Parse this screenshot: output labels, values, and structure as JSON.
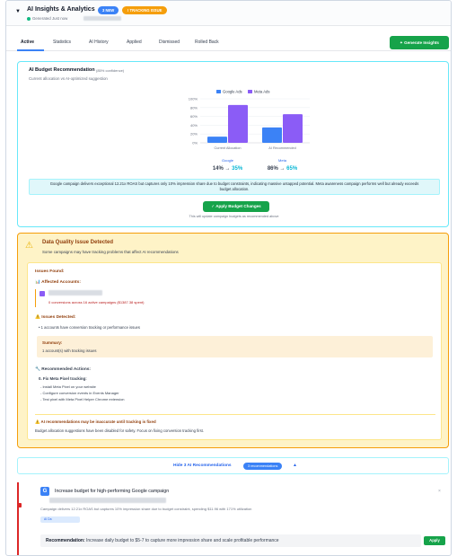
{
  "header": {
    "title": "AI Insights & Analytics",
    "badge_new": "3 NEW",
    "badge_tracking": "! TRACKING ISSUE",
    "generated": "Generated Just now"
  },
  "tabs": [
    {
      "label": "Active",
      "active": true
    },
    {
      "label": "Statistics"
    },
    {
      "label": "AI History"
    },
    {
      "label": "Applied"
    },
    {
      "label": "Dismissed"
    },
    {
      "label": "Rolled Back"
    }
  ],
  "generate_button": "Generate Insights",
  "budget": {
    "title": "AI Budget Recommendation",
    "confidence": "(85% confidence)",
    "subtitle": "Current allocation vs AI-optimized suggestion",
    "info": "Google campaign delivers exceptional 12.21x ROAS but captures only 10% impression share due to budget constraints, indicating massive untapped potential. Meta awareness campaign performs well but already exceeds budget allocation.",
    "apply_label": "✓ Apply Budget Changes",
    "apply_note": "This will update campaign budgets as recommended above"
  },
  "chart_data": {
    "type": "bar",
    "categories": [
      "Current Allocation",
      "AI Recommended"
    ],
    "series": [
      {
        "name": "Google Ads",
        "values": [
          14,
          35
        ],
        "color": "#3b82f6"
      },
      {
        "name": "Meta Ads",
        "values": [
          86,
          65
        ],
        "color": "#8b5cf6"
      }
    ],
    "yticks": [
      "0%",
      "20%",
      "40%",
      "60%",
      "80%",
      "100%"
    ],
    "ylim": [
      0,
      100
    ],
    "legend": "top",
    "grid": true,
    "summary": [
      {
        "label": "Google",
        "from": "14%",
        "arrow": "→",
        "to": "35%"
      },
      {
        "label": "Meta",
        "from": "86%",
        "arrow": "→",
        "to": "65%"
      }
    ]
  },
  "data_quality": {
    "title": "Data Quality Issue Detected",
    "subtitle": "Some campaigns may have tracking problems that affect AI recommendations",
    "issues_found": "Issues Found:",
    "affected_accounts": "📊 Affected Accounts:",
    "account_detail": "0 conversions across 16 active campaigns ($1387.38 spent)",
    "issues_detected": "⚠️ Issues Detected:",
    "issue_item": "• 1 accounts have conversion tracking or performance issues",
    "summary_label": "Summary:",
    "summary_value": "1 account(s) with tracking issues",
    "recommended_actions": "🔧 Recommended Actions:",
    "fix_title": "0. Fix Meta Pixel tracking:",
    "fix_steps": [
      "- Install Meta Pixel on your website",
      "- Configure conversion events in Events Manager",
      "- Test pixel with Meta Pixel Helper Chrome extension"
    ],
    "warning": "⚠️ AI recommendations may be inaccurate until tracking is fixed",
    "warning_sub": "Budget allocation suggestions have been disabled for safety. Focus on fixing conversion tracking first."
  },
  "hide_bar": {
    "label": "Hide 3 AI Recommendations",
    "badge": "3 recommendations",
    "chevron": "▲"
  },
  "recommendation_item": {
    "logo": "G",
    "title": "Increase budget for high-performing Google campaign",
    "desc": "Campaign delivers 12.21x ROAS but captures 10% impression share due to budget constraint, spending $11.96 with 171% utilization",
    "badge": "AI Da",
    "rec_label": "Recommendation:",
    "rec_text": "Increase daily budget to $5-7 to capture more impression share and scale profitable performance",
    "apply": "Apply",
    "close": "×"
  }
}
